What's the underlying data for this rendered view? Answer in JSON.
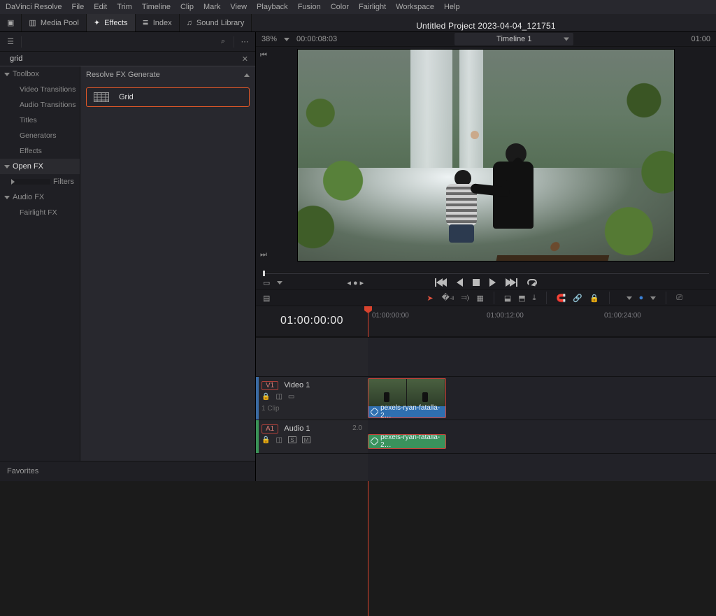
{
  "menu": [
    "DaVinci Resolve",
    "File",
    "Edit",
    "Trim",
    "Timeline",
    "Clip",
    "Mark",
    "View",
    "Playback",
    "Fusion",
    "Color",
    "Fairlight",
    "Workspace",
    "Help"
  ],
  "toolbar": {
    "media_pool": "Media Pool",
    "effects": "Effects",
    "index": "Index",
    "sound_library": "Sound Library"
  },
  "project_title": "Untitled Project 2023-04-04_121751",
  "rhead": {
    "zoom": "38%",
    "timecode": "00:00:08:03",
    "timeline_name": "Timeline 1",
    "end_tc": "01:00"
  },
  "search": {
    "value": "grid"
  },
  "tree": {
    "toolbox": "Toolbox",
    "toolbox_items": [
      "Video Transitions",
      "Audio Transitions",
      "Titles",
      "Generators",
      "Effects"
    ],
    "openfx": "Open FX",
    "filters": "Filters",
    "audiofx": "Audio FX",
    "fairlight": "Fairlight FX"
  },
  "fx": {
    "category": "Resolve FX Generate",
    "item": "Grid"
  },
  "favorites": "Favorites",
  "tl": {
    "master_tc": "01:00:00:00",
    "ruler": [
      "01:00:00:00",
      "01:00:12:00",
      "01:00:24:00"
    ],
    "v_badge": "V1",
    "v_name": "Video 1",
    "v_sub": "1 Clip",
    "a_badge": "A1",
    "a_name": "Audio 1",
    "a_ch": "2.0",
    "a_s": "S",
    "a_m": "M",
    "clip_label": "pexels-ryan-fatalla-2…",
    "clip_label2": "pexels-ryan-fatalla-2…"
  }
}
